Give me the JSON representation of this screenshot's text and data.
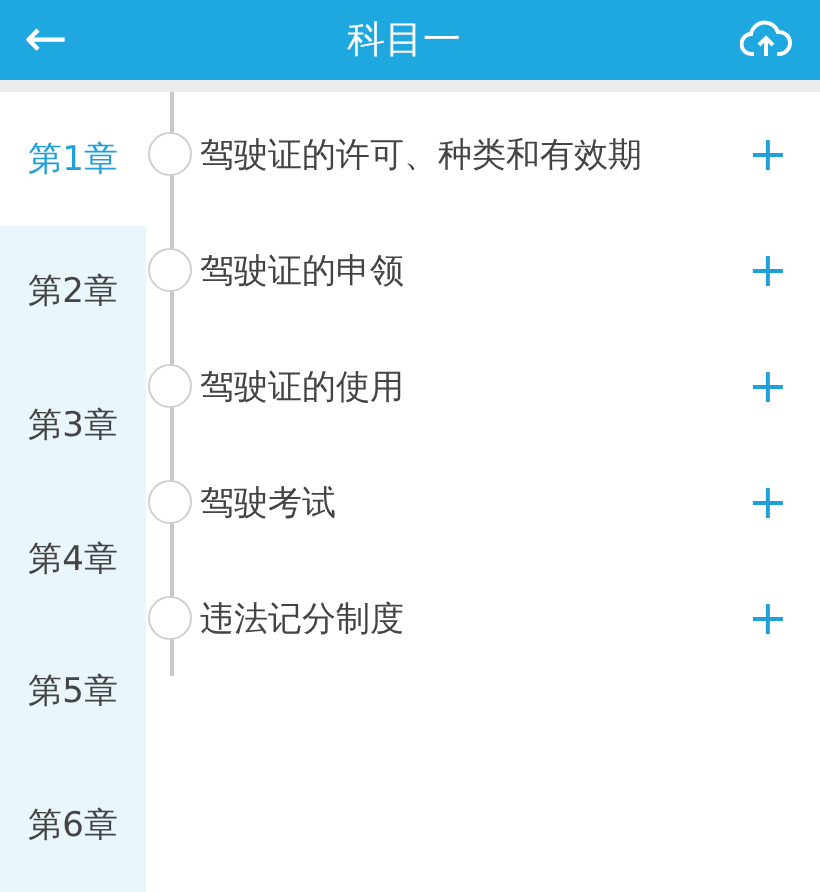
{
  "header": {
    "back": "←",
    "title": "科目一"
  },
  "chapters": [
    {
      "label": "第1章",
      "selected": true
    },
    {
      "label": "第2章",
      "selected": false
    },
    {
      "label": "第3章",
      "selected": false
    },
    {
      "label": "第4章",
      "selected": false
    },
    {
      "label": "第5章",
      "selected": false
    },
    {
      "label": "第6章",
      "selected": false
    }
  ],
  "sections": [
    {
      "title": "驾驶证的许可、种类和有效期",
      "expand": "+"
    },
    {
      "title": "驾驶证的申领",
      "expand": "+"
    },
    {
      "title": "驾驶证的使用",
      "expand": "+"
    },
    {
      "title": "驾驶考试",
      "expand": "+"
    },
    {
      "title": "违法记分制度",
      "expand": "+"
    }
  ]
}
